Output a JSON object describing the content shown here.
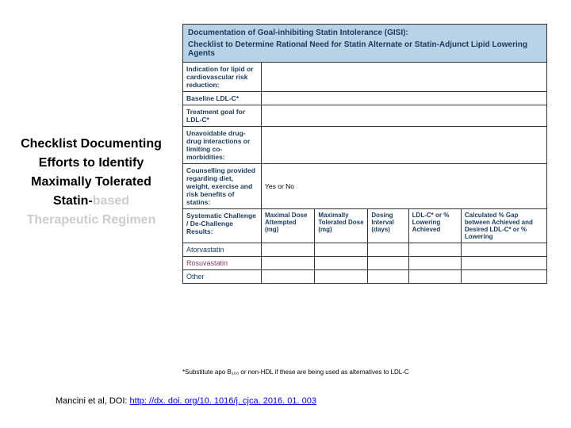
{
  "leftTitle": {
    "line1": "Checklist Documenting Efforts to Identify Maximally Tolerated Statin-",
    "line2": "based Therapeutic Regimen"
  },
  "header": {
    "title": "Documentation of Goal-inhibiting Statin Intolerance (GISI):",
    "subtitle": "Checklist to Determine Rational Need for Statin Alternate or Statin-Adjunct Lipid Lowering Agents"
  },
  "rows": {
    "indication": "Indication for lipid or cardiovascular risk reduction:",
    "baseline": "Baseline LDL-C*",
    "goal": "Treatment goal for LDL-C*",
    "interactions": "Unavoidable drug-drug interactions or limiting co-morbidities:",
    "counselling": "Counselling provided regarding diet, weight, exercise and risk benefits of statins:",
    "counselling_val": "Yes    or    No",
    "challenge": "Systematic Challenge / De-Challenge Results:",
    "col_maxdose": "Maximal Dose Attempted (mg)",
    "col_tolerated": "Maximally Tolerated Dose (mg)",
    "col_interval": "Dosing Interval (days)",
    "col_ldl": "LDL-C* or % Lowering Achieved",
    "col_gap": "Calculated % Gap between Achieved and Desired LDL-C* or % Lowering",
    "atorvastatin": "Atorvastatin",
    "rosuvastatin": "Rosuvastatin",
    "other": "Other"
  },
  "footnote": "*Substitute apo B₁₀₀ or non-HDL if these are being used as alternatives to LDL-C",
  "citation": {
    "prefix": "Mancini et al, DOI: ",
    "link": "http: //dx. doi. org/10. 1016/j. cjca. 2016. 01. 003"
  }
}
